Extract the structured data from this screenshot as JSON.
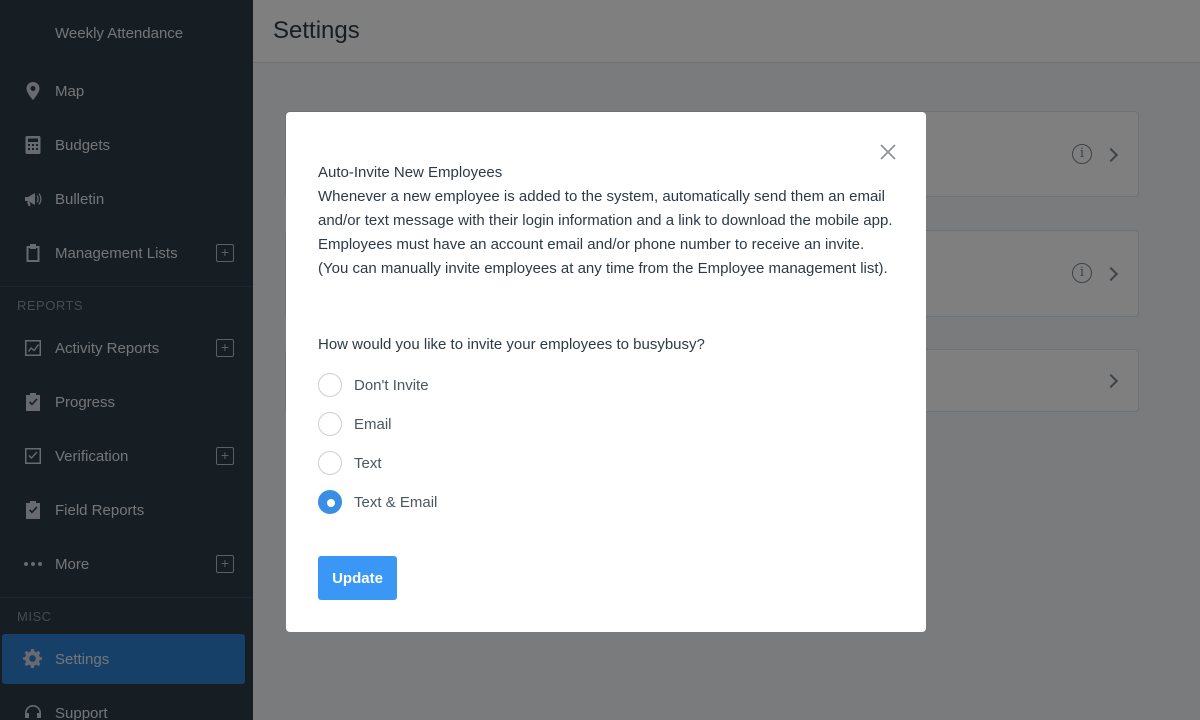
{
  "sidebar": {
    "top_label": "Weekly Attendance",
    "items": [
      {
        "label": "Map",
        "icon": "map-pin-icon"
      },
      {
        "label": "Budgets",
        "icon": "calculator-icon"
      },
      {
        "label": "Bulletin",
        "icon": "megaphone-icon"
      },
      {
        "label": "Management Lists",
        "icon": "clipboard-icon"
      },
      {
        "label": "Activity Reports",
        "icon": "chart-icon"
      },
      {
        "label": "Progress",
        "icon": "clipboard-check-icon"
      },
      {
        "label": "Verification",
        "icon": "checkbox-icon"
      },
      {
        "label": "Field Reports",
        "icon": "clipboard-check-icon"
      },
      {
        "label": "More",
        "icon": "ellipsis-icon"
      },
      {
        "label": "Settings",
        "icon": "gear-icon"
      },
      {
        "label": "Support",
        "icon": "headset-icon"
      }
    ],
    "section_reports": "REPORTS",
    "section_misc": "MISC",
    "expand_glyph": "+",
    "active": "Settings",
    "colors": {
      "bg": "#2c3a47",
      "active": "#2f80d3"
    }
  },
  "main": {
    "title": "Settings",
    "info_glyph": "i"
  },
  "modal": {
    "title": "Auto-Invite New Employees",
    "description": "Whenever a new employee is added to the system, automatically send them an email and/or text message with their login information and a link to download the mobile app. Employees must have an account email and/or phone number to receive an invite. (You can manually invite employees at any time from the Employee management list).",
    "question": "How would you like to invite your employees to busybusy?",
    "options": [
      {
        "label": "Don't Invite",
        "selected": false
      },
      {
        "label": "Email",
        "selected": false
      },
      {
        "label": "Text",
        "selected": false
      },
      {
        "label": "Text & Email",
        "selected": true
      }
    ],
    "update_label": "Update",
    "accent": "#3a97f5"
  }
}
